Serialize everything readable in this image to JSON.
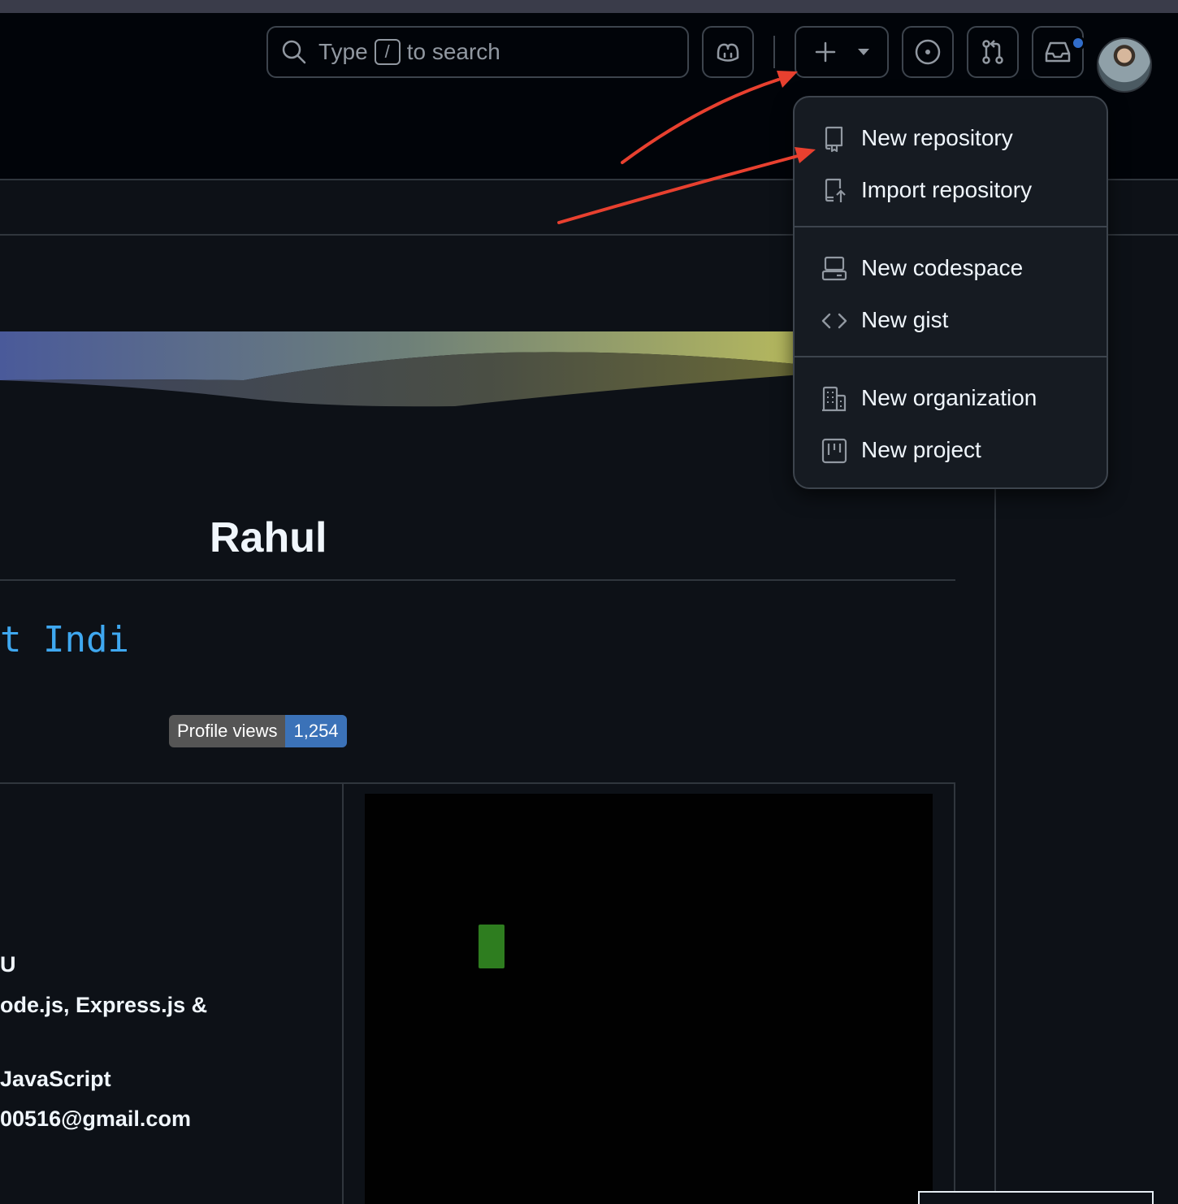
{
  "header": {
    "search": {
      "prefix": "Type",
      "key": "/",
      "suffix": "to search"
    },
    "buttons": [
      "copilot-icon",
      "plus-icon",
      "issues-icon",
      "pull-requests-icon",
      "inbox-icon"
    ]
  },
  "create_menu": {
    "items": [
      {
        "label": "New repository",
        "icon": "repo-icon"
      },
      {
        "label": "Import repository",
        "icon": "repo-push-icon"
      },
      {
        "label": "New codespace",
        "icon": "codespaces-icon"
      },
      {
        "label": "New gist",
        "icon": "code-icon"
      },
      {
        "label": "New organization",
        "icon": "organization-icon"
      },
      {
        "label": "New project",
        "icon": "project-icon"
      }
    ]
  },
  "profile": {
    "name": "Rahul",
    "typing_text": "t Indi",
    "views_badge": {
      "label": "Profile views",
      "value": "1,254"
    },
    "info_lines": [
      "U",
      "ode.js, Express.js &",
      "JavaScript",
      "00516@gmail.com"
    ]
  },
  "colors": {
    "background": "#0d1117",
    "header_bg": "#010409",
    "accent_blue": "#316dca",
    "annotation_red": "#e8402f",
    "typing_color": "#3fa8f0"
  }
}
